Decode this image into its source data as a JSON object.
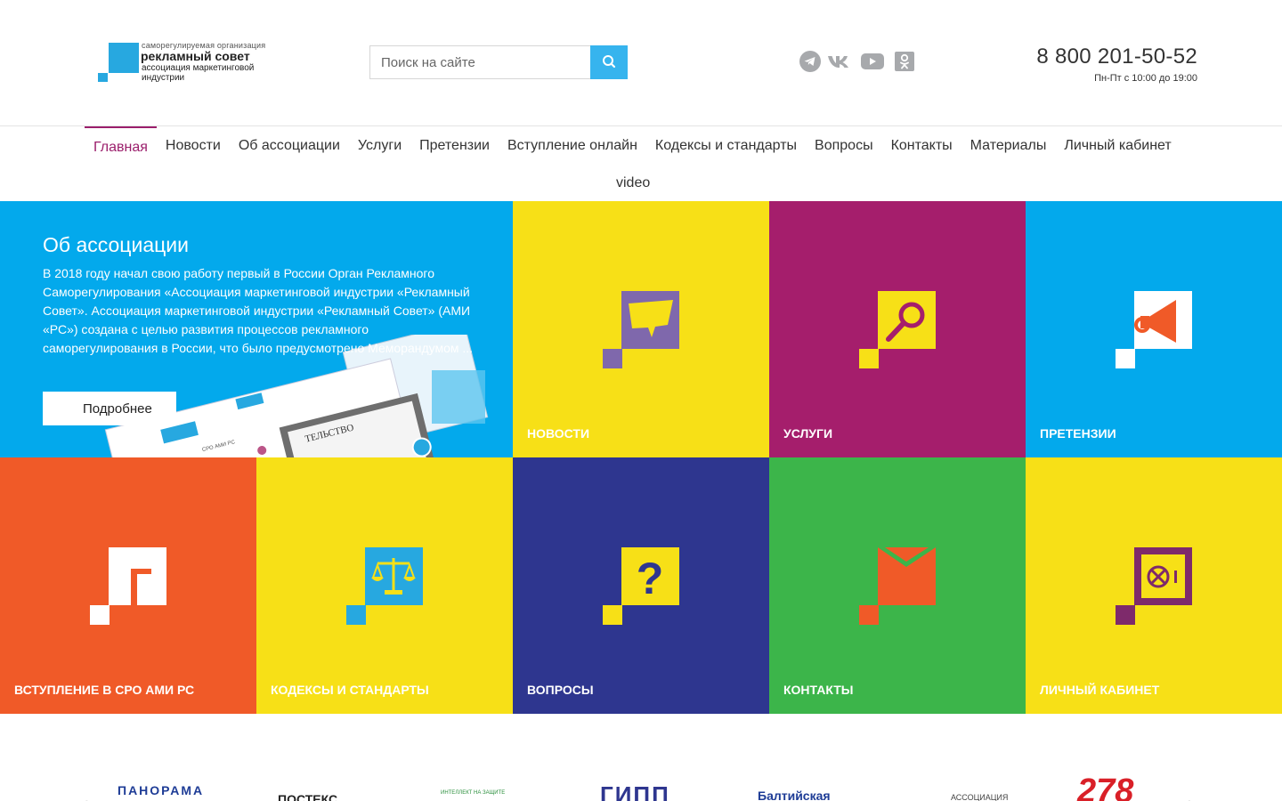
{
  "logo": {
    "line1": "саморегулируемая  организация",
    "line2": "рекламный совет",
    "line3": "ассоциация маркетинговой индустрии"
  },
  "search": {
    "placeholder": "Поиск на сайте"
  },
  "socials": [
    "telegram-icon",
    "vk-icon",
    "youtube-icon",
    "odnoklassniki-icon"
  ],
  "contact": {
    "phone": "8 800 201-50-52",
    "hours": "Пн-Пт с 10:00 до 19:00"
  },
  "nav": {
    "items": [
      "Главная",
      "Новости",
      "Об ассоциации",
      "Услуги",
      "Претензии",
      "Вступление онлайн",
      "Кодексы и стандарты",
      "Вопросы",
      "Контакты",
      "Материалы",
      "Личный кабинет"
    ],
    "active": "Главная",
    "row2": [
      "video"
    ]
  },
  "about": {
    "title": "Об ассоциации",
    "text": "В 2018 году начал свою работу первый в России Орган Рекламного Саморегулирования «Ассоциация маркетинговой индустрии «Рекламный Совет». Ассоциация маркетинговой индустрии «Рекламный Совет» (АМИ «РС») создана с целью развития процессов рекламного саморегулирования в России, что было предусмотрено Меморандумом ...",
    "button": "Подробнее"
  },
  "tiles": [
    {
      "label": "НОВОСТИ",
      "bg": "#f7e017",
      "icon": "chat-bubble-icon"
    },
    {
      "label": "УСЛУГИ",
      "bg": "#a51e6c",
      "icon": "magnifier-icon"
    },
    {
      "label": "ПРЕТЕНЗИИ",
      "bg": "#03a9ec",
      "icon": "megaphone-icon"
    },
    {
      "label": "ВСТУПЛЕНИЕ В СРО АМИ РС",
      "bg": "#f05a28",
      "icon": "entry-icon"
    },
    {
      "label": "КОДЕКСЫ И СТАНДАРТЫ",
      "bg": "#f7e017",
      "icon": "scales-icon"
    },
    {
      "label": "ВОПРОСЫ",
      "bg": "#2e368f",
      "icon": "question-icon"
    },
    {
      "label": "КОНТАКТЫ",
      "bg": "#3cb54a",
      "icon": "envelope-icon"
    },
    {
      "label": "ЛИЧНЫЙ КАБИНЕТ",
      "bg": "#f7e017",
      "icon": "safe-icon"
    }
  ],
  "partners": [
    "ПАНОРАМА",
    "ПОСТЕКС",
    "ИНТЕЛЛЕКТ НА ЗАЩИТЕ",
    "ГИПП",
    "Балтийская",
    "АССОЦИАЦИЯ",
    "278"
  ],
  "colors": {
    "accent": "#9b1f6c",
    "search_button": "#36b4ee",
    "logo_blue": "#27a8e0"
  }
}
